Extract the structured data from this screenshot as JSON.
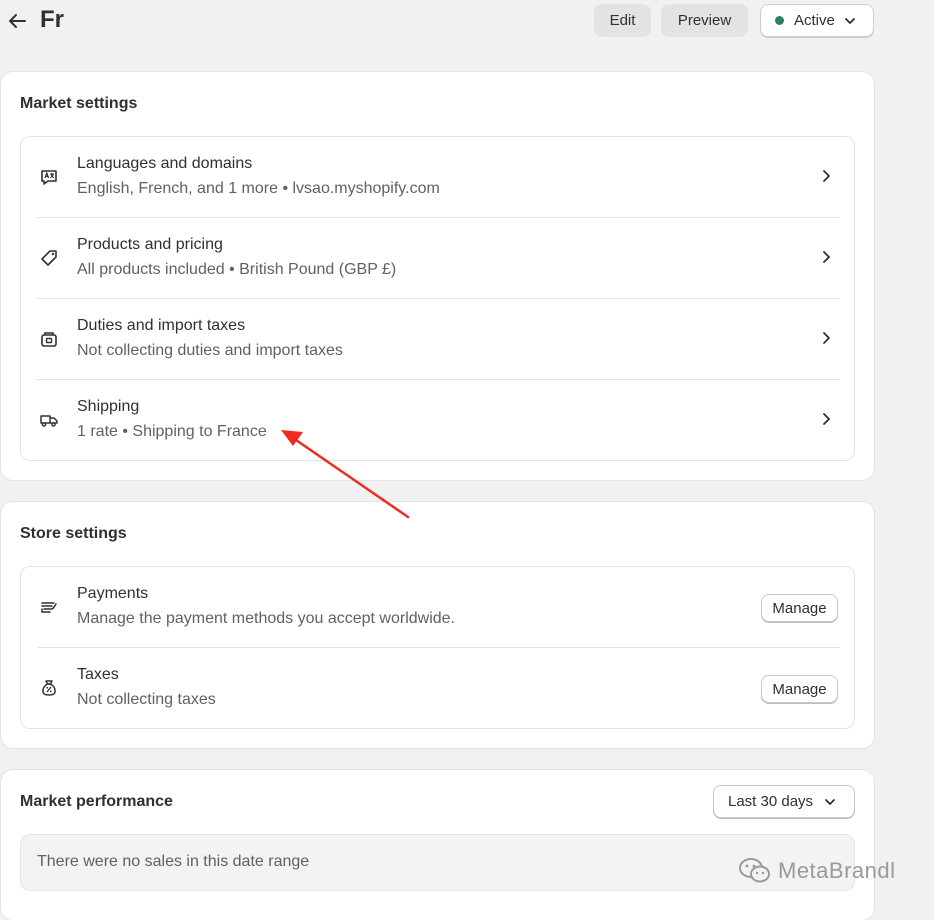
{
  "header": {
    "title": "Fr",
    "edit_label": "Edit",
    "preview_label": "Preview",
    "status_label": "Active",
    "status_color": "#29845a"
  },
  "market_settings": {
    "title": "Market settings",
    "items": [
      {
        "icon": "language-icon",
        "title": "Languages and domains",
        "subtitle": "English, French, and 1 more • lvsao.myshopify.com"
      },
      {
        "icon": "price-tag-icon",
        "title": "Products and pricing",
        "subtitle": "All products included • British Pound (GBP £)"
      },
      {
        "icon": "duties-box-icon",
        "title": "Duties and import taxes",
        "subtitle": "Not collecting duties and import taxes"
      },
      {
        "icon": "delivery-truck-icon",
        "title": "Shipping",
        "subtitle": "1 rate • Shipping to France"
      }
    ]
  },
  "store_settings": {
    "title": "Store settings",
    "items": [
      {
        "icon": "payment-hand-icon",
        "title": "Payments",
        "subtitle": "Manage the payment methods you accept worldwide.",
        "button": "Manage"
      },
      {
        "icon": "tax-bag-icon",
        "title": "Taxes",
        "subtitle": "Not collecting taxes",
        "button": "Manage"
      }
    ]
  },
  "market_performance": {
    "title": "Market performance",
    "date_range": "Last 30 days",
    "empty_message": "There were no sales in this date range"
  },
  "annotation": {
    "arrow_color": "#f02a22"
  },
  "watermark": {
    "text": "MetaBrandl"
  }
}
